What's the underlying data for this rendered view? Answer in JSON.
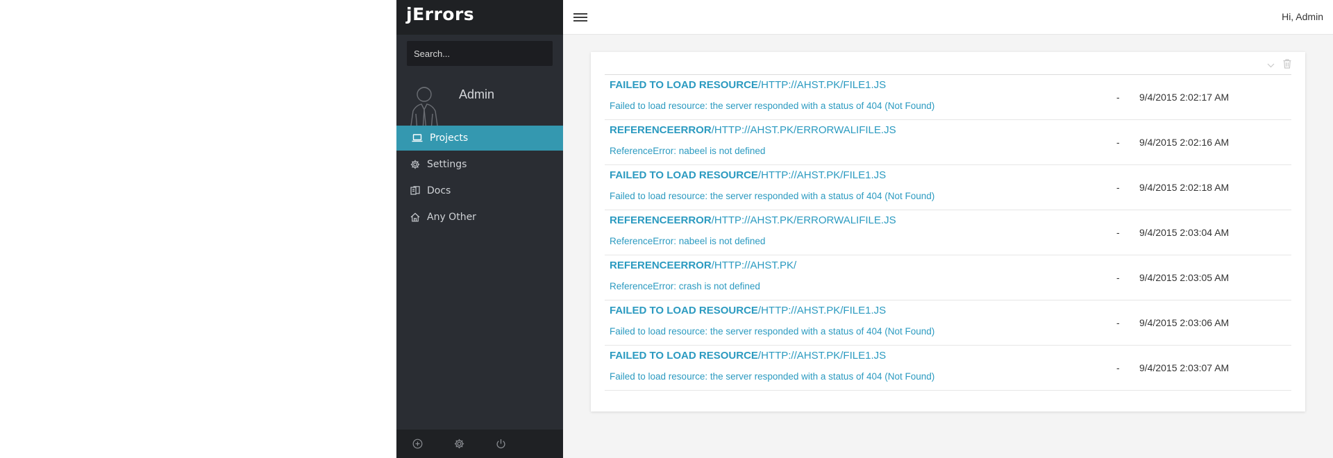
{
  "app": {
    "title": "jErrors"
  },
  "sidebar": {
    "search": {
      "placeholder": "Search...",
      "value": ""
    },
    "profile": {
      "name": "Admin"
    },
    "nav": [
      {
        "label": "Projects",
        "icon": "laptop-icon",
        "active": true
      },
      {
        "label": "Settings",
        "icon": "gear-icon",
        "active": false
      },
      {
        "label": "Docs",
        "icon": "docs-icon",
        "active": false
      },
      {
        "label": "Any Other",
        "icon": "home-icon",
        "active": false
      }
    ],
    "footer_icons": [
      "add-circle-icon",
      "gear-icon",
      "power-icon"
    ]
  },
  "topbar": {
    "greeting": "Hi, Admin"
  },
  "errors": [
    {
      "type": "FAILED TO LOAD RESOURCE",
      "url": "/HTTP://AHST.PK/FILE1.JS",
      "message": "Failed to load resource: the server responded with a status of 404 (Not Found)",
      "dash": "-",
      "time": "9/4/2015 2:02:17 AM"
    },
    {
      "type": "REFERENCEERROR",
      "url": "/HTTP://AHST.PK/ERRORWALIFILE.JS",
      "message": "ReferenceError: nabeel is not defined",
      "dash": "-",
      "time": "9/4/2015 2:02:16 AM"
    },
    {
      "type": "FAILED TO LOAD RESOURCE",
      "url": "/HTTP://AHST.PK/FILE1.JS",
      "message": "Failed to load resource: the server responded with a status of 404 (Not Found)",
      "dash": "-",
      "time": "9/4/2015 2:02:18 AM"
    },
    {
      "type": "REFERENCEERROR",
      "url": "/HTTP://AHST.PK/ERRORWALIFILE.JS",
      "message": "ReferenceError: nabeel is not defined",
      "dash": "-",
      "time": "9/4/2015 2:03:04 AM"
    },
    {
      "type": "REFERENCEERROR",
      "url": "/HTTP://AHST.PK/",
      "message": "ReferenceError: crash is not defined",
      "dash": "-",
      "time": "9/4/2015 2:03:05 AM"
    },
    {
      "type": "FAILED TO LOAD RESOURCE",
      "url": "/HTTP://AHST.PK/FILE1.JS",
      "message": "Failed to load resource: the server responded with a status of 404 (Not Found)",
      "dash": "-",
      "time": "9/4/2015 2:03:06 AM"
    },
    {
      "type": "FAILED TO LOAD RESOURCE",
      "url": "/HTTP://AHST.PK/FILE1.JS",
      "message": "Failed to load resource: the server responded with a status of 404 (Not Found)",
      "dash": "-",
      "time": "9/4/2015 2:03:07 AM"
    }
  ],
  "card_tools": [
    "chevron-down-icon",
    "trash-icon"
  ],
  "colors": {
    "accent": "#3498b0",
    "link": "#2b9ac0",
    "sidebar": "#2a2d33",
    "sidebar_dark": "#1f2124"
  }
}
